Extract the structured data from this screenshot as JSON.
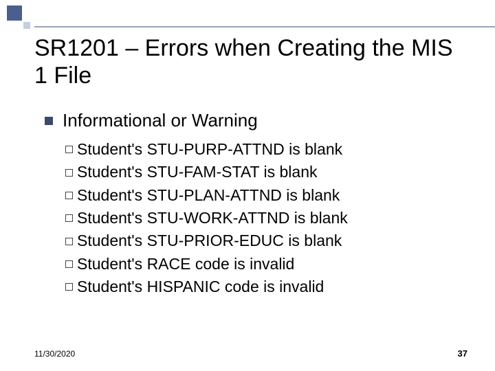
{
  "title": "SR1201 – Errors when Creating the MIS 1 File",
  "section_heading": "Informational or Warning",
  "items": [
    "Student's STU-PURP-ATTND is blank",
    "Student's STU-FAM-STAT is blank",
    "Student's STU-PLAN-ATTND is blank",
    "Student's STU-WORK-ATTND is blank",
    "Student's STU-PRIOR-EDUC is blank",
    "Student's RACE code is invalid",
    "Student's HISPANIC code is invalid"
  ],
  "footer": {
    "date": "11/30/2020",
    "page": "37"
  }
}
